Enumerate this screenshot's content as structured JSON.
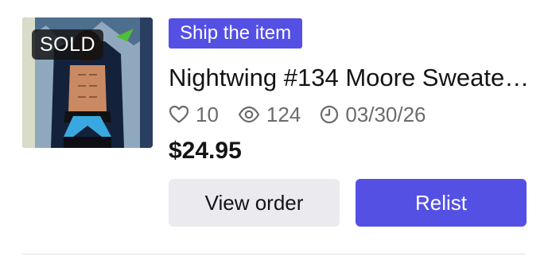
{
  "listing": {
    "sold_badge": "SOLD",
    "status": "Ship the item",
    "title": "Nightwing #134 Moore Sweate…",
    "likes": "10",
    "views": "124",
    "date": "03/30/26",
    "price": "$24.95",
    "thumbnail_icon": "comic-cover-image"
  },
  "actions": {
    "view_order_label": "View order",
    "relist_label": "Relist"
  },
  "icons": {
    "likes": "heart-icon",
    "views": "eye-icon",
    "date": "clock-icon"
  },
  "colors": {
    "accent": "#5450e4",
    "secondary_button_bg": "#ebebef",
    "muted_text": "#6b6b6b"
  }
}
